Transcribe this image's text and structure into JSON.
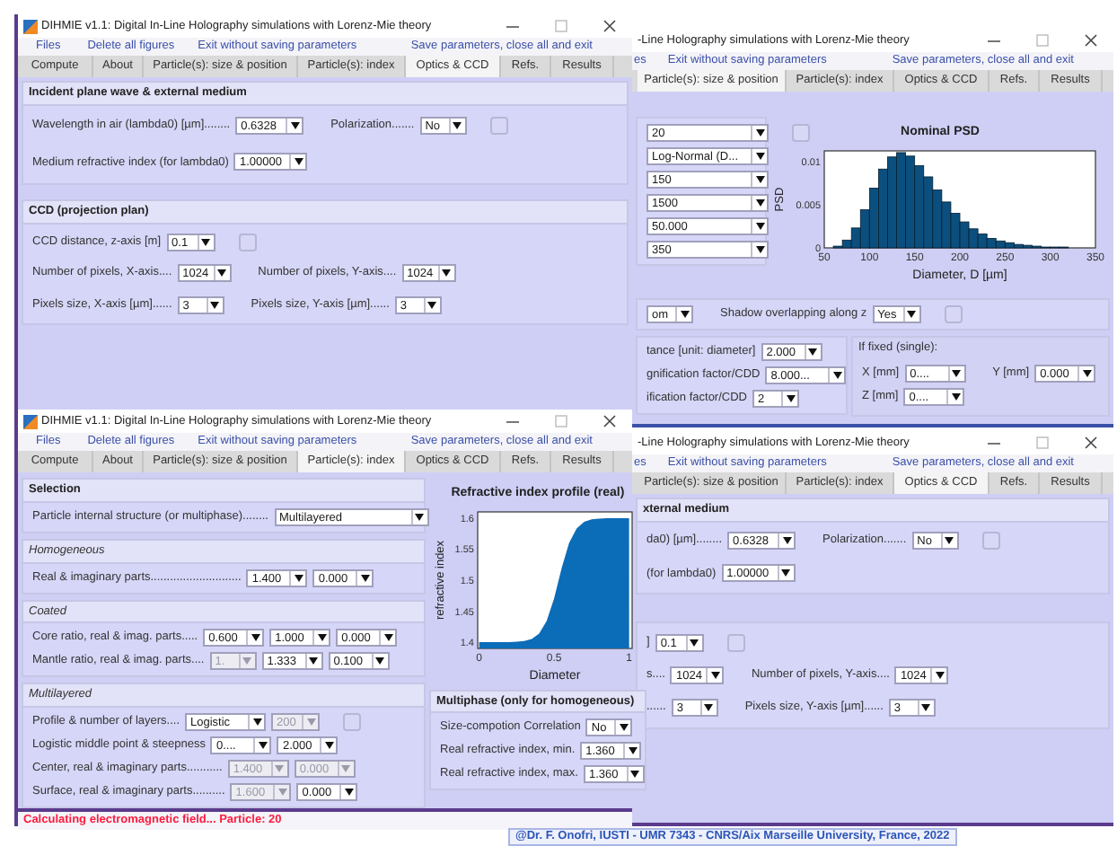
{
  "windows": [
    {
      "title": "DIHMIE v1.1: Digital In-Line Holography simulations with Lorenz-Mie theory",
      "menu": [
        "Files",
        "Delete all figures",
        "Exit without saving parameters",
        "Save parameters, close all and exit"
      ],
      "tabs": [
        {
          "label": "Compute",
          "selected": false
        },
        {
          "label": "About",
          "selected": false
        },
        {
          "label": "Particle(s): size & position",
          "selected": false
        },
        {
          "label": "Particle(s): index",
          "selected": false
        },
        {
          "label": "Optics & CCD",
          "selected": true
        },
        {
          "label": "Refs.",
          "selected": false
        },
        {
          "label": "Results",
          "selected": false
        }
      ],
      "body": [
        {
          "kind": "section",
          "title": "Incident plane wave & external medium",
          "rows": [
            [
              {
                "kind": "label",
                "text": "Wavelength in air (lambda0) [µm]........"
              },
              {
                "kind": "dropdown",
                "value": "0.6328",
                "disabled": false
              },
              {
                "kind": "label",
                "text": "Polarization......."
              },
              {
                "kind": "dropdown",
                "value": "No",
                "disabled": false
              },
              {
                "kind": "checkbox",
                "checked": false
              }
            ],
            [
              {
                "kind": "label",
                "text": "Medium refractive index (for lambda0)"
              },
              {
                "kind": "dropdown",
                "value": "1.00000",
                "disabled": false
              }
            ]
          ]
        },
        {
          "kind": "section",
          "title": "CCD  (projection plan)",
          "rows": [
            [
              {
                "kind": "label",
                "text": "CCD distance, z-axis [m]"
              },
              {
                "kind": "dropdown",
                "value": "0.1",
                "disabled": false
              },
              {
                "kind": "checkbox",
                "checked": false
              }
            ],
            [
              {
                "kind": "label",
                "text": "Number of pixels, X-axis...."
              },
              {
                "kind": "dropdown",
                "value": "1024",
                "disabled": false
              },
              {
                "kind": "label",
                "text": "Number of pixels, Y-axis...."
              },
              {
                "kind": "dropdown",
                "value": "1024",
                "disabled": false
              }
            ],
            [
              {
                "kind": "label",
                "text": "Pixels size, X-axis [µm]......"
              },
              {
                "kind": "dropdown",
                "value": "3",
                "disabled": false
              },
              {
                "kind": "label",
                "text": "Pixels size, Y-axis [µm]......"
              },
              {
                "kind": "dropdown",
                "value": "3",
                "disabled": false
              }
            ]
          ]
        }
      ]
    },
    {
      "title": "-Line Holography simulations with Lorenz-Mie theory",
      "menu": [
        "es",
        "Exit without saving parameters",
        "Save parameters, close all and exit"
      ],
      "tabs": [
        {
          "label": "Particle(s): size & position",
          "selected": true
        },
        {
          "label": "Particle(s): index",
          "selected": false
        },
        {
          "label": "Optics & CCD",
          "selected": false
        },
        {
          "label": "Refs.",
          "selected": false
        },
        {
          "label": "Results",
          "selected": false
        }
      ],
      "body": [
        {
          "kind": "split",
          "columns": [
            [
              {
                "kind": "panel",
                "rows": [
                  [
                    {
                      "kind": "dropdown",
                      "value": "20",
                      "disabled": false
                    },
                    {
                      "kind": "checkbox",
                      "checked": false
                    }
                  ],
                  [
                    {
                      "kind": "dropdown",
                      "value": "Log-Normal (D...",
                      "disabled": false
                    }
                  ],
                  [
                    {
                      "kind": "dropdown",
                      "value": "150",
                      "disabled": false
                    }
                  ],
                  [
                    {
                      "kind": "dropdown",
                      "value": "1500",
                      "disabled": false
                    }
                  ],
                  [
                    {
                      "kind": "dropdown",
                      "value": "50.000",
                      "disabled": false
                    }
                  ],
                  [
                    {
                      "kind": "dropdown",
                      "value": "350",
                      "disabled": false
                    }
                  ]
                ]
              }
            ],
            [
              {
                "kind": "chart",
                "chart_data": {
                  "type": "bar",
                  "title": "Nominal PSD",
                  "xlabel": "Diameter, D [µm]",
                  "ylabel": "PSD",
                  "x": [
                    55,
                    65,
                    75,
                    85,
                    95,
                    105,
                    115,
                    125,
                    135,
                    145,
                    155,
                    165,
                    175,
                    185,
                    195,
                    205,
                    215,
                    225,
                    235,
                    245,
                    255,
                    265,
                    275,
                    285,
                    295,
                    305,
                    315,
                    325,
                    335,
                    345
                  ],
                  "values": [
                    0,
                    0.0002,
                    0.0009,
                    0.0023,
                    0.0044,
                    0.0069,
                    0.0091,
                    0.0105,
                    0.011,
                    0.0106,
                    0.0095,
                    0.0082,
                    0.0067,
                    0.0053,
                    0.004,
                    0.003,
                    0.0022,
                    0.0016,
                    0.0011,
                    0.0008,
                    0.0006,
                    0.0004,
                    0.0003,
                    0.0002,
                    0.0001,
                    0.0001,
                    0.0001,
                    0,
                    0,
                    0
                  ],
                  "xlim": [
                    50,
                    350
                  ],
                  "ylim": [
                    0,
                    0.0112
                  ],
                  "xticks": [
                    50,
                    100,
                    150,
                    200,
                    250,
                    300,
                    350
                  ],
                  "yticks": [
                    0,
                    0.005,
                    0.01
                  ]
                }
              }
            ]
          ]
        },
        {
          "kind": "panel",
          "rows": [
            [
              {
                "kind": "dropdown",
                "value": "om",
                "disabled": false
              },
              {
                "kind": "label",
                "text": "Shadow overlapping along z"
              },
              {
                "kind": "dropdown",
                "value": "Yes",
                "disabled": false
              },
              {
                "kind": "checkbox",
                "checked": false
              }
            ]
          ]
        },
        {
          "kind": "split",
          "columns": [
            [
              {
                "kind": "panel",
                "rows": [
                  [
                    {
                      "kind": "label",
                      "text": "tance [unit: diameter]"
                    },
                    {
                      "kind": "dropdown",
                      "value": "2.000",
                      "disabled": false
                    }
                  ],
                  [
                    {
                      "kind": "label",
                      "text": "gnification factor/CDD"
                    },
                    {
                      "kind": "dropdown",
                      "value": "8.000...",
                      "disabled": false
                    }
                  ],
                  [
                    {
                      "kind": "label",
                      "text": "ification factor/CDD"
                    },
                    {
                      "kind": "dropdown",
                      "value": "2",
                      "disabled": false
                    }
                  ]
                ]
              }
            ],
            [
              {
                "kind": "group",
                "title": "If fixed (single):",
                "rows": [
                  [
                    {
                      "kind": "label",
                      "text": "X [mm]"
                    },
                    {
                      "kind": "dropdown",
                      "value": "0....",
                      "disabled": false
                    },
                    {
                      "kind": "label",
                      "text": "Y [mm]"
                    },
                    {
                      "kind": "dropdown",
                      "value": "0.000",
                      "disabled": false
                    }
                  ],
                  [
                    {
                      "kind": "label",
                      "text": "Z [mm]"
                    },
                    {
                      "kind": "dropdown",
                      "value": "0....",
                      "disabled": false
                    }
                  ]
                ]
              }
            ]
          ]
        }
      ]
    },
    {
      "title": "DIHMIE v1.1: Digital In-Line Holography simulations with Lorenz-Mie theory",
      "menu": [
        "Files",
        "Delete all figures",
        "Exit without saving parameters",
        "Save parameters, close all and exit"
      ],
      "tabs": [
        {
          "label": "Compute",
          "selected": false
        },
        {
          "label": "About",
          "selected": false
        },
        {
          "label": "Particle(s): size & position",
          "selected": false
        },
        {
          "label": "Particle(s): index",
          "selected": true
        },
        {
          "label": "Optics & CCD",
          "selected": false
        },
        {
          "label": "Refs.",
          "selected": false
        },
        {
          "label": "Results",
          "selected": false
        }
      ],
      "body": [
        {
          "kind": "split",
          "columns": [
            [
              {
                "kind": "section",
                "title": "Selection",
                "rows": [
                  [
                    {
                      "kind": "label",
                      "text": "Particle internal structure (or multiphase)........"
                    },
                    {
                      "kind": "dropdown",
                      "value": "Multilayered",
                      "disabled": false
                    }
                  ]
                ]
              },
              {
                "kind": "subsection",
                "title": "Homogeneous",
                "rows": [
                  [
                    {
                      "kind": "label",
                      "text": "Real & imaginary parts............................"
                    },
                    {
                      "kind": "dropdown",
                      "value": "1.400",
                      "disabled": false
                    },
                    {
                      "kind": "dropdown",
                      "value": "0.000",
                      "disabled": false
                    }
                  ]
                ]
              },
              {
                "kind": "subsection",
                "title": "Coated",
                "rows": [
                  [
                    {
                      "kind": "label",
                      "text": "Core ratio, real & imag. parts....."
                    },
                    {
                      "kind": "dropdown",
                      "value": "0.600",
                      "disabled": false
                    },
                    {
                      "kind": "dropdown",
                      "value": "1.000",
                      "disabled": false
                    },
                    {
                      "kind": "dropdown",
                      "value": "0.000",
                      "disabled": false
                    }
                  ],
                  [
                    {
                      "kind": "label",
                      "text": "Mantle ratio, real & imag. parts...."
                    },
                    {
                      "kind": "dropdown",
                      "value": "1.",
                      "disabled": true
                    },
                    {
                      "kind": "dropdown",
                      "value": "1.333",
                      "disabled": false
                    },
                    {
                      "kind": "dropdown",
                      "value": "0.100",
                      "disabled": false
                    }
                  ]
                ]
              },
              {
                "kind": "subsection",
                "title": "Multilayered",
                "rows": [
                  [
                    {
                      "kind": "label",
                      "text": "Profile & number of layers...."
                    },
                    {
                      "kind": "dropdown",
                      "value": "Logistic",
                      "disabled": false
                    },
                    {
                      "kind": "dropdown",
                      "value": "200",
                      "disabled": true
                    },
                    {
                      "kind": "checkbox",
                      "checked": false
                    }
                  ],
                  [
                    {
                      "kind": "label",
                      "text": "Logistic middle point & steepness"
                    },
                    {
                      "kind": "dropdown",
                      "value": "0....",
                      "disabled": false
                    },
                    {
                      "kind": "dropdown",
                      "value": "2.000",
                      "disabled": false
                    }
                  ],
                  [
                    {
                      "kind": "label",
                      "text": "Center, real & imaginary parts..........."
                    },
                    {
                      "kind": "dropdown",
                      "value": "1.400",
                      "disabled": true
                    },
                    {
                      "kind": "dropdown",
                      "value": "0.000",
                      "disabled": true
                    }
                  ],
                  [
                    {
                      "kind": "label",
                      "text": "Surface, real & imaginary parts.........."
                    },
                    {
                      "kind": "dropdown",
                      "value": "1.600",
                      "disabled": true
                    },
                    {
                      "kind": "dropdown",
                      "value": "0.000",
                      "disabled": false
                    }
                  ]
                ]
              }
            ],
            [
              {
                "kind": "chart",
                "chart_data": {
                  "type": "area",
                  "title": "Refractive index profile (real)",
                  "xlabel": "Diameter",
                  "ylabel": "refractive index",
                  "x": [
                    0,
                    0.05,
                    0.1,
                    0.15,
                    0.2,
                    0.25,
                    0.3,
                    0.35,
                    0.4,
                    0.45,
                    0.5,
                    0.55,
                    0.6,
                    0.65,
                    0.7,
                    0.75,
                    0.8,
                    0.85,
                    0.9,
                    0.95,
                    1
                  ],
                  "values": [
                    1.4,
                    1.4,
                    1.4,
                    1.4,
                    1.4,
                    1.401,
                    1.402,
                    1.405,
                    1.414,
                    1.434,
                    1.471,
                    1.52,
                    1.56,
                    1.583,
                    1.594,
                    1.598,
                    1.599,
                    1.6,
                    1.6,
                    1.6,
                    1.6
                  ],
                  "xlim": [
                    -0.01,
                    1.02
                  ],
                  "ylim": [
                    1.39,
                    1.61
                  ],
                  "xticks": [
                    0,
                    0.5,
                    1
                  ],
                  "yticks": [
                    1.4,
                    1.45,
                    1.5,
                    1.55,
                    1.6
                  ]
                }
              },
              {
                "kind": "section",
                "title": "Multiphase (only for homogeneous)",
                "rows": [
                  [
                    {
                      "kind": "label",
                      "text": "Size-compotion Correlation"
                    },
                    {
                      "kind": "dropdown",
                      "value": "No",
                      "disabled": false
                    }
                  ],
                  [
                    {
                      "kind": "label",
                      "text": "Real refractive index, min."
                    },
                    {
                      "kind": "dropdown",
                      "value": "1.360",
                      "disabled": false
                    }
                  ],
                  [
                    {
                      "kind": "label",
                      "text": "Real refractive index, max."
                    },
                    {
                      "kind": "dropdown",
                      "value": "1.360",
                      "disabled": false
                    }
                  ]
                ]
              }
            ]
          ]
        }
      ],
      "status_bar": {
        "text": "Calculating electromagnetic field... Particle: 20",
        "kind": "error"
      }
    },
    {
      "title": "-Line Holography simulations with Lorenz-Mie theory",
      "menu": [
        "es",
        "Exit without saving parameters",
        "Save parameters, close all and exit"
      ],
      "tabs": [
        {
          "label": "Particle(s): size & position",
          "selected": false
        },
        {
          "label": "Particle(s): index",
          "selected": false
        },
        {
          "label": "Optics & CCD",
          "selected": true
        },
        {
          "label": "Refs.",
          "selected": false
        },
        {
          "label": "Results",
          "selected": false
        }
      ],
      "body": [
        {
          "kind": "section",
          "title": "xternal medium",
          "rows": [
            [
              {
                "kind": "label",
                "text": "da0) [µm]........"
              },
              {
                "kind": "dropdown",
                "value": "0.6328",
                "disabled": false
              },
              {
                "kind": "label",
                "text": "Polarization......."
              },
              {
                "kind": "dropdown",
                "value": "No",
                "disabled": false
              },
              {
                "kind": "checkbox",
                "checked": false
              }
            ],
            [
              {
                "kind": "label",
                "text": "(for lambda0)"
              },
              {
                "kind": "dropdown",
                "value": "1.00000",
                "disabled": false
              }
            ]
          ]
        },
        {
          "kind": "panel",
          "rows": [
            [
              {
                "kind": "label",
                "text": "]"
              },
              {
                "kind": "dropdown",
                "value": "0.1",
                "disabled": false
              },
              {
                "kind": "checkbox",
                "checked": false
              }
            ],
            [
              {
                "kind": "label",
                "text": "s...."
              },
              {
                "kind": "dropdown",
                "value": "1024",
                "disabled": false
              },
              {
                "kind": "label",
                "text": "Number of pixels, Y-axis...."
              },
              {
                "kind": "dropdown",
                "value": "1024",
                "disabled": false
              }
            ],
            [
              {
                "kind": "label",
                "text": "......"
              },
              {
                "kind": "dropdown",
                "value": "3",
                "disabled": false
              },
              {
                "kind": "label",
                "text": "Pixels size, Y-axis [µm]......"
              },
              {
                "kind": "dropdown",
                "value": "3",
                "disabled": false
              }
            ]
          ]
        }
      ]
    }
  ],
  "footer": "@Dr. F. Onofri, IUSTI - UMR 7343 - CNRS/Aix Marseille University, France, 2022"
}
